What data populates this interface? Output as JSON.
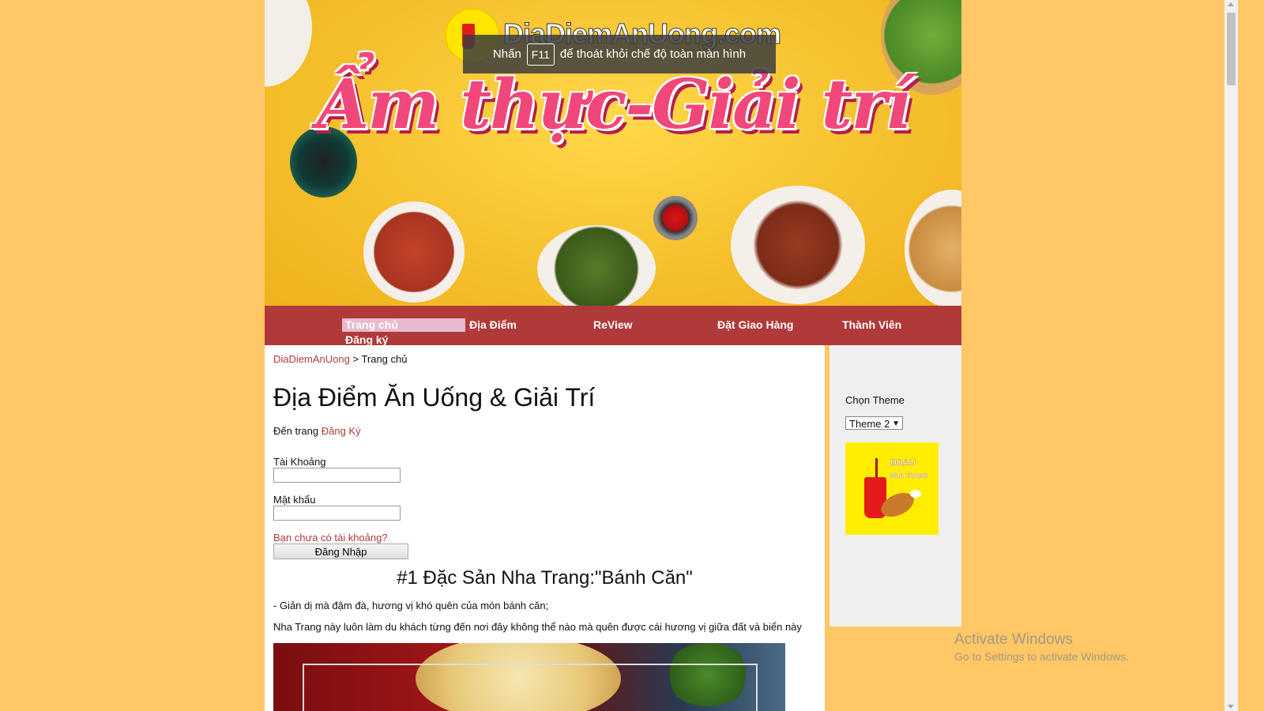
{
  "banner": {
    "logo_text": "DiaDiemAnUong.com",
    "title": "Ẩm thực-Giải trí"
  },
  "fullscreen_toast": {
    "before": "Nhấn",
    "key": "F11",
    "after": "để thoát khỏi chế độ toàn màn hình"
  },
  "nav": {
    "home": "Trang chủ",
    "places": "Địa Điểm",
    "review": "ReView",
    "delivery": "Đặt Giao Hàng",
    "members": "Thành Viên",
    "register": "Đăng ký"
  },
  "breadcrumb": {
    "root": "DiaDiemAnUong",
    "separator": ">",
    "current": "Trang chủ"
  },
  "main": {
    "title": "Địa Điểm Ăn Uống & Giải Trí",
    "goto_prefix": "Đến trang",
    "goto_link": "Đăng Ký",
    "account_label": "Tài Khoảng",
    "account_value": "",
    "password_label": "Mật khẩu",
    "password_value": "",
    "no_account_link": "Bạn chưa có tài khoảng?",
    "login_button": "Đăng Nhập"
  },
  "article": {
    "title": "#1 Đặc Sản Nha Trang:\"Bánh Căn\"",
    "line1": "- Giản dị mà đậm đà, hương vị khó quên của món bánh căn;",
    "line2": "Nha Trang này luôn làm du khách từng đến nơi đây không thể nào mà quên được cái hương vị giữa đất và biển này"
  },
  "sidebar": {
    "theme_label": "Chọn Theme",
    "theme_selected": "Theme 2",
    "logo_text1": "DDAU",
    "logo_text2": "NHA TRANG"
  },
  "watermark": {
    "title": "Activate Windows",
    "subtitle": "Go to Settings to activate Windows."
  },
  "colors": {
    "page_background": "#ffc766",
    "nav_background": "#b03a3a",
    "nav_active": "#e8bad0",
    "link": "#b03a3a"
  }
}
